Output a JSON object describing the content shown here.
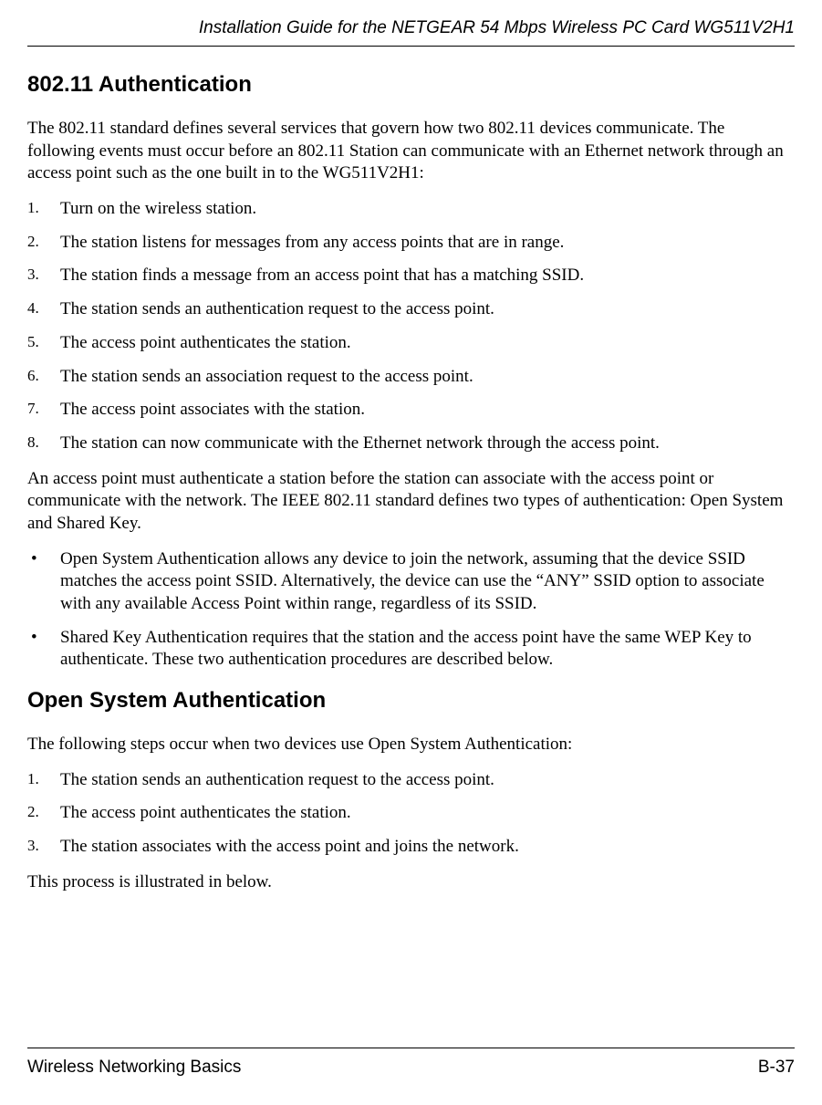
{
  "header": {
    "title": "Installation Guide for the NETGEAR 54 Mbps Wireless PC Card WG511V2H1"
  },
  "section1": {
    "heading": "802.11 Authentication",
    "intro": "The 802.11 standard defines several services that govern how two 802.11 devices communicate. The following events must occur before an 802.11 Station can communicate with an Ethernet network through an access point such as the one built in to the WG511V2H1:",
    "steps": [
      "Turn on the wireless station.",
      "The station listens for messages from any access points that are in range.",
      "The station finds a message from an access point that has a matching SSID.",
      "The station sends an authentication request to the access point.",
      "The access point authenticates the station.",
      "The station sends an association request to the access point.",
      "The access point associates with the station.",
      "The station can now communicate with the Ethernet network through the access point."
    ],
    "para2": "An access point must authenticate a station before the station can associate with the access point or communicate with the network. The IEEE 802.11 standard defines two types of authentication: Open System and Shared Key.",
    "bullets": [
      "Open System Authentication allows any device to join the network, assuming that the device SSID matches the access point SSID. Alternatively, the device can use the “ANY” SSID option to associate with any available Access Point within range, regardless of its SSID.",
      "Shared Key Authentication requires that the station and the access point have the same WEP Key to authenticate. These two authentication procedures are described below."
    ]
  },
  "section2": {
    "heading": "Open System Authentication",
    "intro": "The following steps occur when two devices use Open System Authentication:",
    "steps": [
      "The station sends an authentication request to the access point.",
      "The access point authenticates the station.",
      "The station associates with the access point and joins the network."
    ],
    "outro": "This process is illustrated in below."
  },
  "footer": {
    "left": "Wireless Networking Basics",
    "right": "B-37"
  }
}
